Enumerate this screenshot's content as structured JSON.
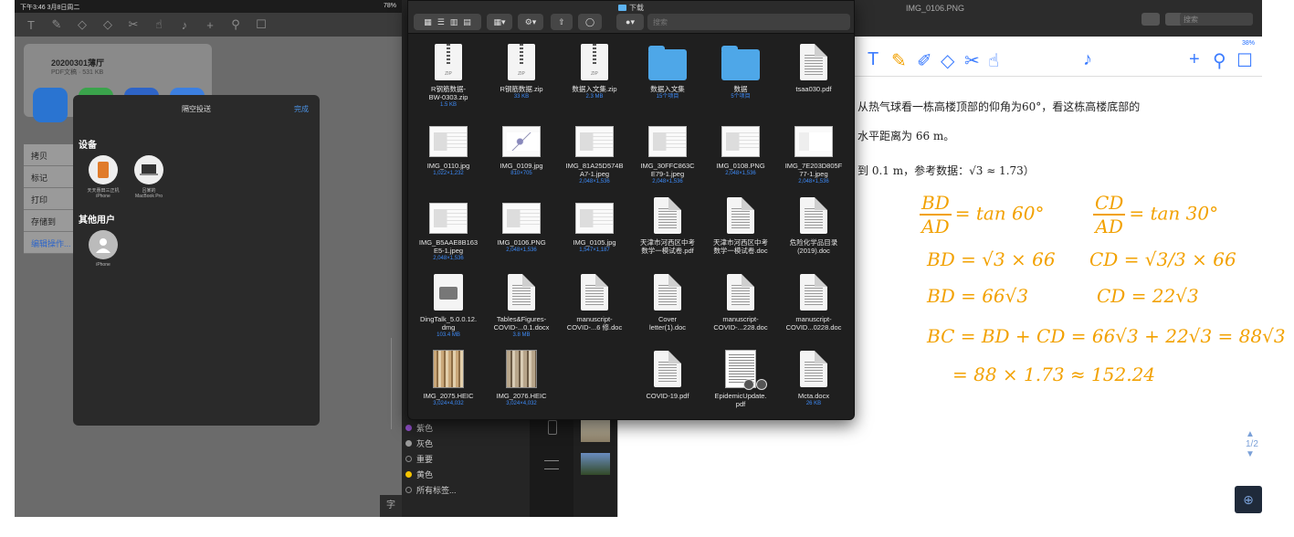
{
  "left_ipad": {
    "status_left": "下午3:46  3月8日周二",
    "status_right": "78%",
    "toolbar_tools": [
      "T",
      "✎",
      "◇",
      "◇",
      "✂",
      "☝",
      "♪",
      "+",
      "⚲",
      "☐"
    ],
    "share_doc_name": "20200301薄厅",
    "share_doc_sub": "PDF文稿 · 531 KB",
    "airdrop_label": "隔空投送",
    "share_list": [
      "拷贝",
      "标记",
      "打印",
      "存储到"
    ],
    "share_more": "编辑操作...",
    "airdrop_title": "隔空投送",
    "airdrop_done": "完成",
    "devices_heading": "设备",
    "others_heading": "其他用户",
    "devices": [
      {
        "name": "天天惠田三正机",
        "sub": "iPhone"
      },
      {
        "name": "吕某的",
        "sub": "MacBook Pro"
      }
    ],
    "others": [
      {
        "name": "iPhone"
      }
    ],
    "corner_label": "字"
  },
  "middle": {
    "tag_labels": [
      {
        "label": "紫色",
        "color": "#8e4ec6"
      },
      {
        "label": "灰色",
        "color": "#9a9a9a"
      },
      {
        "label": "重要",
        "color": "#444444"
      },
      {
        "label": "黄色",
        "color": "#f5c400"
      },
      {
        "label": "所有标签...",
        "color": "#777777"
      }
    ]
  },
  "right_doc": {
    "filename": "IMG_0106.PNG",
    "search_placeholder": "搜索",
    "status": "38%",
    "toolbar_tools": [
      "T",
      "✎",
      "✐",
      "◇",
      "✂",
      "☝",
      "♪",
      "+",
      "⚲",
      "☐"
    ],
    "problem_lines": [
      "从热气球看一栋高楼顶部的仰角为60°，看这栋高楼底部的",
      "水平距离为 66 m。",
      "到 0.1 m，参考数据：√3 ≈ 1.73）"
    ],
    "handwriting": {
      "frac1_num": "BD",
      "frac1_den": "AD",
      "frac1_rhs": "= tan 60°",
      "frac2_num": "CD",
      "frac2_den": "AD",
      "frac2_rhs": "= tan 30°",
      "line2_left": "BD = √3 × 66",
      "line2_right": "CD = √3/3 × 66",
      "line3_left": "BD = 66√3",
      "line3_right": "CD = 22√3",
      "line4": "BC = BD + CD = 66√3 + 22√3 = 88√3",
      "line5": "= 88 × 1.73 ≈ 152.24"
    },
    "page_indicator": "1/2"
  },
  "finder": {
    "title": "下载",
    "search_placeholder": "搜索",
    "files": [
      {
        "name": "R钢筋数据-\nBW-0303.zip",
        "meta": "1.5 KB",
        "type": "zip"
      },
      {
        "name": "R钢筋数据.zip",
        "meta": "33 KB",
        "type": "zip"
      },
      {
        "name": "数据入文集.zip",
        "meta": "2.3 MB",
        "type": "zip"
      },
      {
        "name": "数据入文集",
        "meta": "15个项目",
        "type": "folder"
      },
      {
        "name": "数据",
        "meta": "5个项目",
        "type": "folder"
      },
      {
        "name": "tsaa030.pdf",
        "meta": "",
        "type": "doc"
      },
      {
        "name": "IMG_0110.jpg",
        "meta": "1,022×1,232",
        "type": "img"
      },
      {
        "name": "IMG_0109.jpg",
        "meta": "810×705",
        "type": "img-math"
      },
      {
        "name": "IMG_81A25D574B\nA7-1.jpeg",
        "meta": "2,048×1,536",
        "type": "img"
      },
      {
        "name": "IMG_30FFC863C\nE79-1.jpeg",
        "meta": "2,048×1,536",
        "type": "img"
      },
      {
        "name": "IMG_0108.PNG",
        "meta": "2,048×1,536",
        "type": "img"
      },
      {
        "name": "IMG_7E203D805F\n77-1.jpeg",
        "meta": "2,048×1,536",
        "type": "img-diagram"
      },
      {
        "name": "IMG_B5AAE8B163\nE5-1.jpeg",
        "meta": "2,048×1,536",
        "type": "img"
      },
      {
        "name": "IMG_0106.PNG",
        "meta": "2,048×1,536",
        "type": "img"
      },
      {
        "name": "IMG_0105.jpg",
        "meta": "1,547×1,187",
        "type": "img"
      },
      {
        "name": "天津市河西区中考\n数学一模试卷.pdf",
        "meta": "",
        "type": "doc"
      },
      {
        "name": "天津市河西区中考\n数学一模试卷.doc",
        "meta": "",
        "type": "doc"
      },
      {
        "name": "危险化学品目录\n(2019).doc",
        "meta": "",
        "type": "doc"
      },
      {
        "name": "DingTalk_5.0.0.12.\ndmg",
        "meta": "103.4 MB",
        "type": "dmg"
      },
      {
        "name": "Tables&Figures-\nCOVID-...0.1.docx",
        "meta": "3.8 MB",
        "type": "doc"
      },
      {
        "name": "manuscript-\nCOVID-...6 修.doc",
        "meta": "",
        "type": "doc"
      },
      {
        "name": "Cover\nletter(1).doc",
        "meta": "",
        "type": "doc"
      },
      {
        "name": "manuscript-\nCOVID-...228.doc",
        "meta": "",
        "type": "doc"
      },
      {
        "name": "manuscript-\nCOVID...0228.doc",
        "meta": "",
        "type": "doc"
      },
      {
        "name": "IMG_2075.HEIC",
        "meta": "3,024×4,032",
        "type": "photo"
      },
      {
        "name": "IMG_2076.HEIC",
        "meta": "3,024×4,032",
        "type": "photo-b"
      },
      {
        "name": "",
        "meta": "",
        "type": "empty"
      },
      {
        "name": "COVID-19.pdf",
        "meta": "",
        "type": "doc"
      },
      {
        "name": "EpidemicUpdate.\npdf",
        "meta": "",
        "type": "pdf-cover"
      },
      {
        "name": "Mcta.docx",
        "meta": "26 KB",
        "type": "doc"
      }
    ]
  }
}
